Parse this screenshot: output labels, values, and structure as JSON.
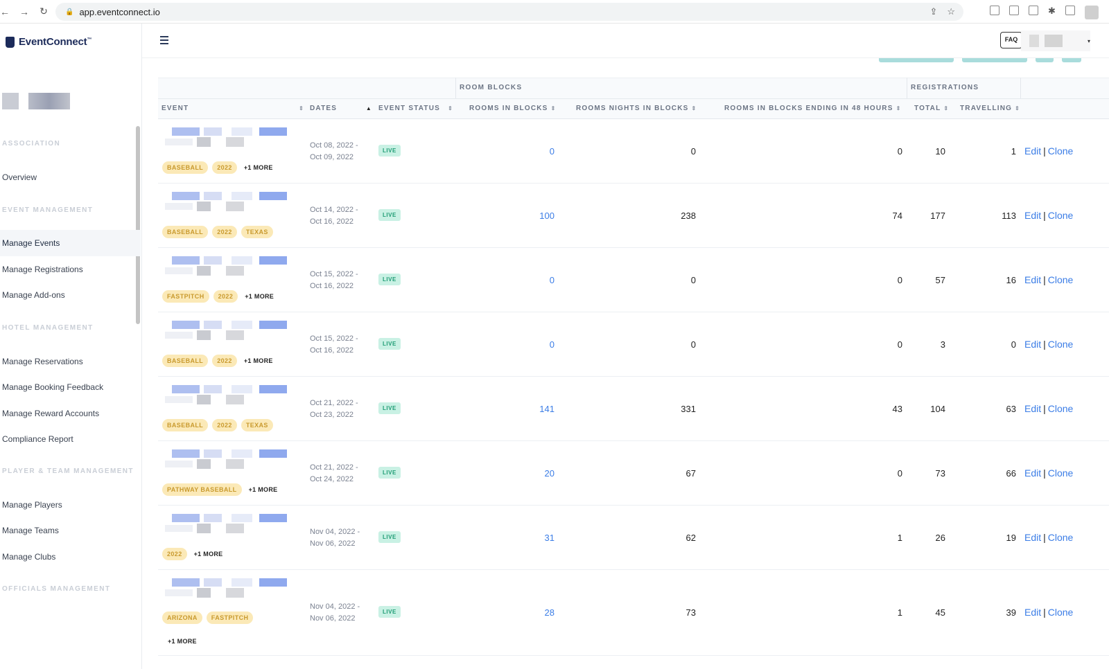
{
  "browser": {
    "url": "app.eventconnect.io"
  },
  "brand": {
    "name": "EventConnect",
    "tm": "™"
  },
  "sidebar": {
    "sections": [
      {
        "title": "ASSOCIATION",
        "items": [
          "Overview"
        ]
      },
      {
        "title": "EVENT MANAGEMENT",
        "items": [
          "Manage Events",
          "Manage Registrations",
          "Manage Add-ons"
        ]
      },
      {
        "title": "HOTEL MANAGEMENT",
        "items": [
          "Manage Reservations",
          "Manage Booking Feedback",
          "Manage Reward Accounts",
          "Compliance Report"
        ]
      },
      {
        "title": "PLAYER & TEAM MANAGEMENT",
        "items": [
          "Manage Players",
          "Manage Teams",
          "Manage Clubs"
        ]
      },
      {
        "title": "OFFICIALS MANAGEMENT",
        "items": []
      }
    ],
    "active": "Manage Events"
  },
  "topbar": {
    "faq": "FAQ"
  },
  "table": {
    "groups": {
      "room_blocks": "ROOM BLOCKS",
      "registrations": "REGISTRATIONS"
    },
    "columns": {
      "event": "EVENT",
      "dates": "DATES",
      "status": "EVENT STATUS",
      "rooms": "ROOMS IN BLOCKS",
      "nights": "ROOMS NIGHTS IN BLOCKS",
      "ending": "ROOMS IN BLOCKS ENDING IN 48 HOURS",
      "total": "TOTAL",
      "travelling": "TRAVELLING"
    },
    "edit_label": "Edit",
    "clone_label": "Clone",
    "rows": [
      {
        "tags": [
          "BASEBALL",
          "2022"
        ],
        "more": "+1 MORE",
        "date_start": "Oct 08, 2022 -",
        "date_end": "Oct 09, 2022",
        "status": "LIVE",
        "rooms": "0",
        "nights": "0",
        "ending": "0",
        "total": "10",
        "travelling": "1"
      },
      {
        "tags": [
          "BASEBALL",
          "2022",
          "TEXAS"
        ],
        "more": "",
        "date_start": "Oct 14, 2022 -",
        "date_end": "Oct 16, 2022",
        "status": "LIVE",
        "rooms": "100",
        "nights": "238",
        "ending": "74",
        "total": "177",
        "travelling": "113"
      },
      {
        "tags": [
          "FASTPITCH",
          "2022"
        ],
        "more": "+1 MORE",
        "date_start": "Oct 15, 2022 -",
        "date_end": "Oct 16, 2022",
        "status": "LIVE",
        "rooms": "0",
        "nights": "0",
        "ending": "0",
        "total": "57",
        "travelling": "16"
      },
      {
        "tags": [
          "BASEBALL",
          "2022"
        ],
        "more": "+1 MORE",
        "date_start": "Oct 15, 2022 -",
        "date_end": "Oct 16, 2022",
        "status": "LIVE",
        "rooms": "0",
        "nights": "0",
        "ending": "0",
        "total": "3",
        "travelling": "0"
      },
      {
        "tags": [
          "BASEBALL",
          "2022",
          "TEXAS"
        ],
        "more": "",
        "date_start": "Oct 21, 2022 -",
        "date_end": "Oct 23, 2022",
        "status": "LIVE",
        "rooms": "141",
        "nights": "331",
        "ending": "43",
        "total": "104",
        "travelling": "63"
      },
      {
        "tags": [
          "PATHWAY BASEBALL"
        ],
        "more": "+1 MORE",
        "date_start": "Oct 21, 2022 -",
        "date_end": "Oct 24, 2022",
        "status": "LIVE",
        "rooms": "20",
        "nights": "67",
        "ending": "0",
        "total": "73",
        "travelling": "66"
      },
      {
        "tags": [
          "2022"
        ],
        "more": "+1 MORE",
        "date_start": "Nov 04, 2022 -",
        "date_end": "Nov 06, 2022",
        "status": "LIVE",
        "rooms": "31",
        "nights": "62",
        "ending": "1",
        "total": "26",
        "travelling": "19"
      },
      {
        "tags": [
          "ARIZONA",
          "FASTPITCH"
        ],
        "more": "+1 MORE",
        "date_start": "Nov 04, 2022 -",
        "date_end": "Nov 06, 2022",
        "status": "LIVE",
        "rooms": "28",
        "nights": "73",
        "ending": "1",
        "total": "45",
        "travelling": "39"
      }
    ]
  }
}
